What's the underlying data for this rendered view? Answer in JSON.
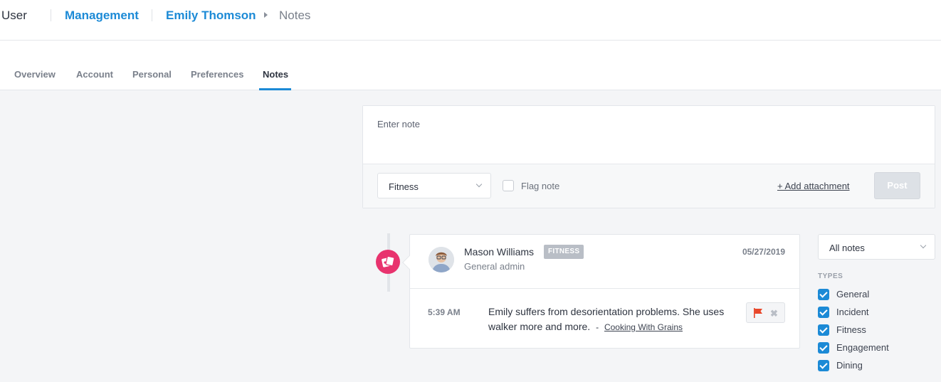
{
  "breadcrumb": {
    "root": "User",
    "section": "Management",
    "person": "Emily Thomson",
    "current": "Notes"
  },
  "tabs": [
    "Overview",
    "Account",
    "Personal",
    "Preferences",
    "Notes"
  ],
  "active_tab": "Notes",
  "composer": {
    "placeholder": "Enter note",
    "type_select": "Fitness",
    "flag_label": "Flag note",
    "flag_checked": false,
    "add_attachment": "+ Add attachment",
    "post_label": "Post"
  },
  "notes": [
    {
      "author": "Mason Williams",
      "badge": "FITNESS",
      "role": "General admin",
      "date": "05/27/2019",
      "time": "5:39 AM",
      "text": "Emily suffers from desorientation problems. She uses walker more and more.",
      "separator": "-",
      "link": "Cooking With Grains",
      "flagged": true
    }
  ],
  "filter": {
    "select": "All notes",
    "types_title": "TYPES",
    "types": [
      {
        "label": "General",
        "checked": true
      },
      {
        "label": "Incident",
        "checked": true
      },
      {
        "label": "Fitness",
        "checked": true
      },
      {
        "label": "Engagement",
        "checked": true
      },
      {
        "label": "Dining",
        "checked": true
      }
    ]
  },
  "colors": {
    "accent": "#1c8ad6",
    "timeline_dot": "#e8336e",
    "flag": "#e8472a",
    "badge": "#b9bec6"
  },
  "icons": {
    "timeline": "cards-icon",
    "note_flag": "flag-icon",
    "note_remove": "close-icon"
  }
}
